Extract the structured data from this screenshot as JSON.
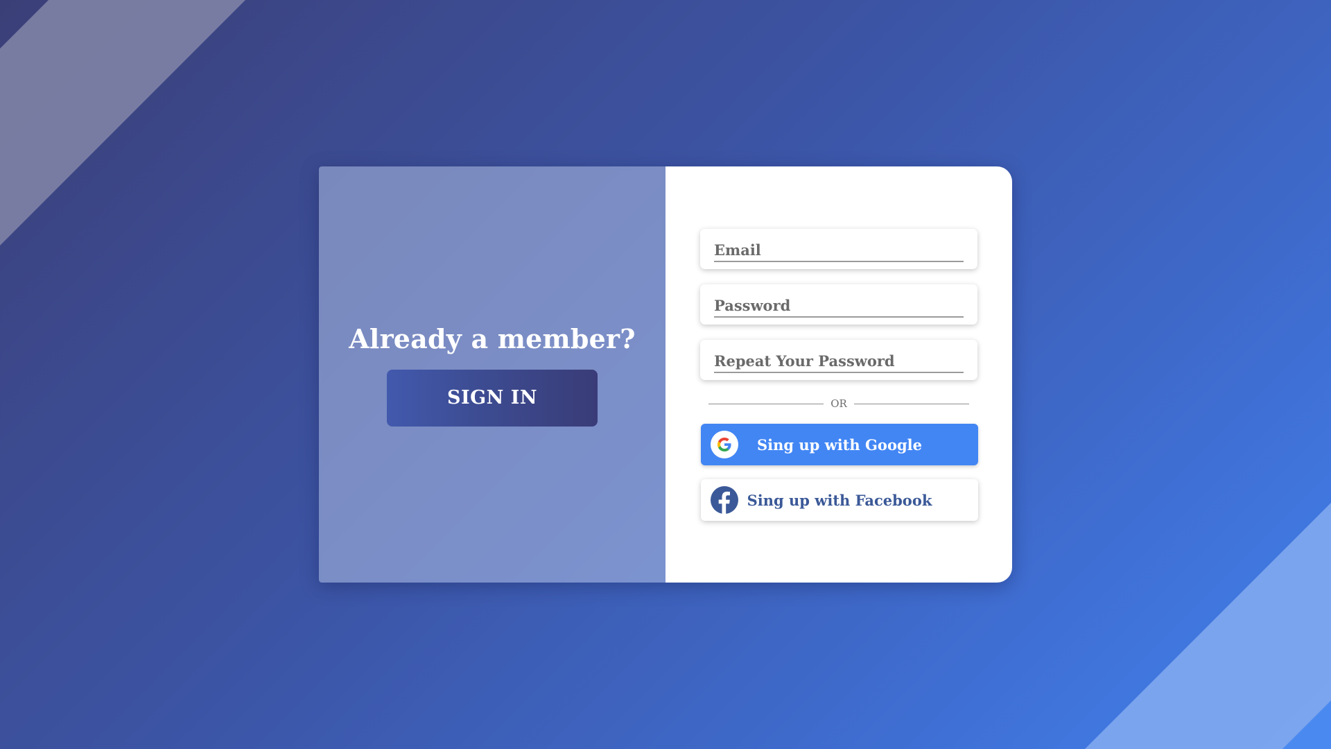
{
  "left_panel": {
    "heading": "Already a member?",
    "signin_label": "SIGN IN"
  },
  "form": {
    "email_placeholder": "Email",
    "password_placeholder": "Password",
    "repeat_password_placeholder": "Repeat Your Password",
    "divider_text": "OR",
    "google_label": "Sing up with Google",
    "facebook_label": "Sing up with Facebook"
  },
  "colors": {
    "google_blue": "#4286f4",
    "facebook_blue": "#3b5998",
    "signin_gradient_start": "#4259ad",
    "signin_gradient_end": "#393c77"
  },
  "icons": {
    "google": "google-g-logo",
    "facebook": "facebook-f-logo"
  }
}
